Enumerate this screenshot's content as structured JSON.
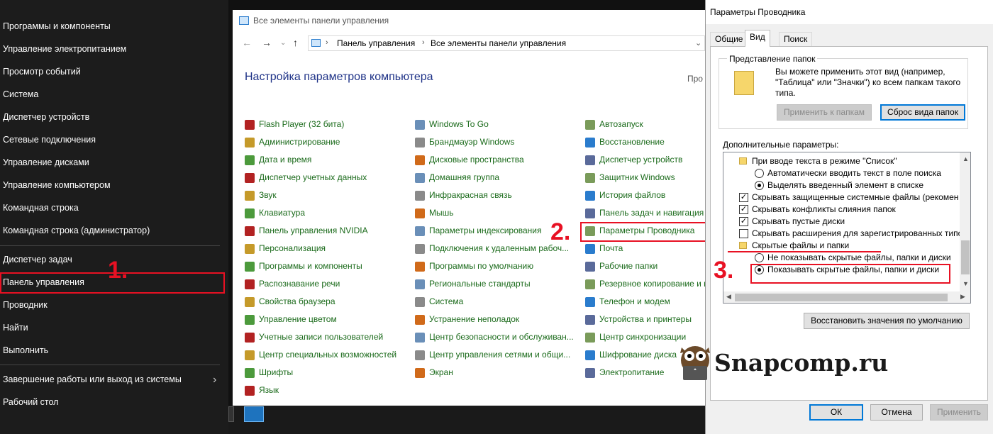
{
  "winx_menu": {
    "items": [
      "Программы и компоненты",
      "Управление электропитанием",
      "Просмотр событий",
      "Система",
      "Диспетчер устройств",
      "Сетевые подключения",
      "Управление дисками",
      "Управление компьютером",
      "Командная строка",
      "Командная строка (администратор)",
      "Диспетчер задач",
      "Панель управления",
      "Проводник",
      "Найти",
      "Выполнить",
      "Завершение работы или выход из системы",
      "Рабочий стол"
    ],
    "highlighted": "Панель управления"
  },
  "step_labels": [
    "1.",
    "2.",
    "3."
  ],
  "control_panel": {
    "window_title": "Все элементы панели управления",
    "breadcrumb": [
      "Панель управления",
      "Все элементы панели управления"
    ],
    "heading": "Настройка параметров компьютера",
    "view_by": "Про",
    "items": [
      [
        "Flash Player (32 бита)",
        "Windows To Go",
        "Автозапуск"
      ],
      [
        "Администрирование",
        "Брандмауэр Windows",
        "Восстановление"
      ],
      [
        "Дата и время",
        "Дисковые пространства",
        "Диспетчер устройств"
      ],
      [
        "Диспетчер учетных данных",
        "Домашняя группа",
        "Защитник Windows"
      ],
      [
        "Звук",
        "Инфракрасная связь",
        "История файлов"
      ],
      [
        "Клавиатура",
        "Мышь",
        "Панель задач и навигация"
      ],
      [
        "Панель управления NVIDIA",
        "Параметры индексирования",
        "Параметры Проводника"
      ],
      [
        "Персонализация",
        "Подключения к удаленным рабоч...",
        "Почта"
      ],
      [
        "Программы и компоненты",
        "Программы по умолчанию",
        "Рабочие папки"
      ],
      [
        "Распознавание речи",
        "Региональные стандарты",
        "Резервное копирование и в"
      ],
      [
        "Свойства браузера",
        "Система",
        "Телефон и модем"
      ],
      [
        "Управление цветом",
        "Устранение неполадок",
        "Устройства и принтеры"
      ],
      [
        "Учетные записи пользователей",
        "Центр безопасности и обслуживан...",
        "Центр синхронизации"
      ],
      [
        "Центр специальных возможностей",
        "Центр управления сетями и общи...",
        "Шифрование диска"
      ],
      [
        "Шрифты",
        "Экран",
        "Электропитание"
      ],
      [
        "Язык",
        "",
        ""
      ]
    ],
    "highlighted": "Параметры Проводника"
  },
  "folder_options": {
    "title": "Параметры Проводника",
    "tabs": [
      "Общие",
      "Вид",
      "Поиск"
    ],
    "active_tab": "Вид",
    "group_label": "Представление папок",
    "group_desc": "Вы можете применить этот вид (например, \"Таблица\" или \"Значки\") ко всем папкам такого типа.",
    "apply_to_folders": "Применить к папкам",
    "reset_folders": "Сброс вида папок",
    "advanced_label": "Дополнительные параметры:",
    "tree": [
      {
        "type": "folder",
        "text": "При вводе текста в режиме \"Список\""
      },
      {
        "type": "radio",
        "checked": false,
        "text": "Автоматически вводить текст в поле поиска"
      },
      {
        "type": "radio",
        "checked": true,
        "text": "Выделять введенный элемент в списке"
      },
      {
        "type": "check",
        "checked": true,
        "text": "Скрывать защищенные системные файлы (рекомен"
      },
      {
        "type": "check",
        "checked": true,
        "text": "Скрывать конфликты слияния папок"
      },
      {
        "type": "check",
        "checked": true,
        "text": "Скрывать пустые диски"
      },
      {
        "type": "check",
        "checked": false,
        "text": "Скрывать расширения для зарегистрированных типо"
      },
      {
        "type": "folder",
        "text": "Скрытые файлы и папки"
      },
      {
        "type": "radio",
        "checked": false,
        "text": "Не показывать скрытые файлы, папки и диски"
      },
      {
        "type": "radio",
        "checked": true,
        "text": "Показывать скрытые файлы, папки и диски"
      }
    ],
    "restore_defaults": "Восстановить значения по умолчанию",
    "ok": "ОК",
    "cancel": "Отмена",
    "apply": "Применить"
  },
  "watermark": "Snapcomp.ru",
  "colors": {
    "highlight": "#e81123",
    "link_green": "#1a6a1a",
    "heading_blue": "#1e3287"
  }
}
